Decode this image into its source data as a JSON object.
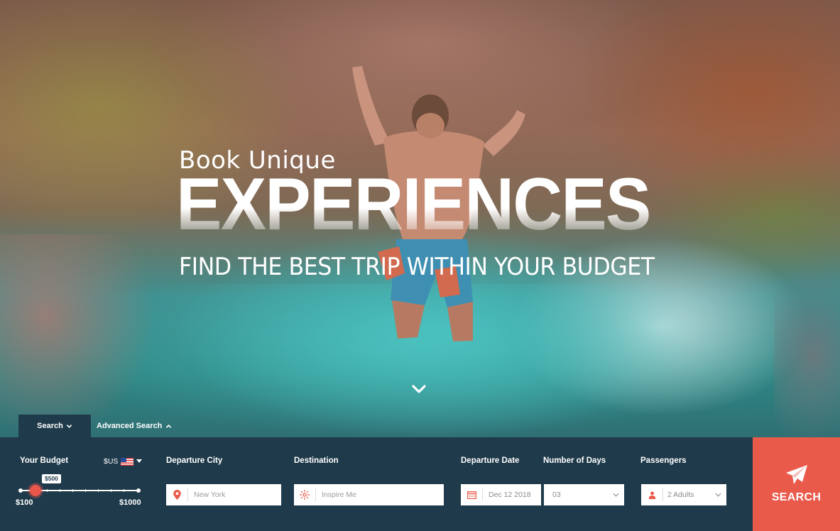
{
  "hero": {
    "eyebrow": "Book Unique",
    "headline": "EXPERIENCES",
    "tagline": "FIND THE BEST TRIP WITHIN YOUR BUDGET",
    "scroll_icon": "chevron-down-icon"
  },
  "tabs": {
    "search": "Search",
    "advanced": "Advanced Search"
  },
  "budget": {
    "label": "Your Budget",
    "currency": "$US",
    "current_value": "$500",
    "min_label": "$100",
    "max_label": "$1000",
    "min": 100,
    "max": 1000,
    "value": 500
  },
  "fields": {
    "departure_city": {
      "label": "Departure City",
      "placeholder": "New York"
    },
    "destination": {
      "label": "Destination",
      "placeholder": "Inspire Me"
    },
    "departure_date": {
      "label": "Departure Date",
      "value": "Dec 12 2018"
    },
    "days": {
      "label": "Number of Days",
      "value": "03"
    },
    "passengers": {
      "label": "Passengers",
      "value": "2 Adults"
    }
  },
  "search_button": {
    "label": "SEARCH",
    "icon": "paper-plane-icon"
  },
  "colors": {
    "accent": "#ea5a4b",
    "bar_bg": "#1f3a4a"
  }
}
